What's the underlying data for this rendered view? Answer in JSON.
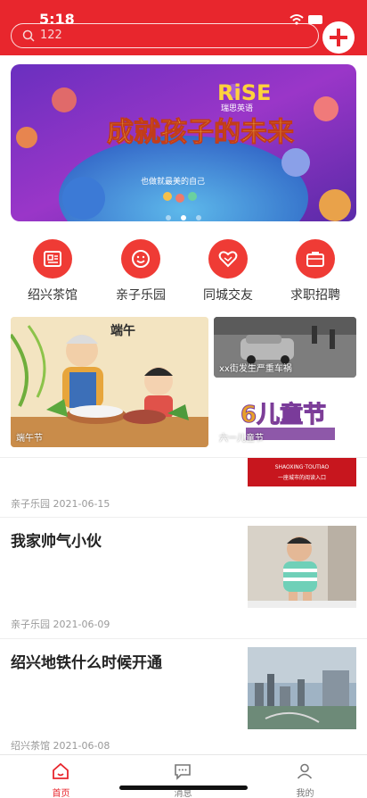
{
  "status": {
    "time": "5:18"
  },
  "search": {
    "placeholder": "122"
  },
  "banner": {
    "headline": "成就孩子的未来",
    "brand": "RiSE",
    "brand_sub": "瑞思英语",
    "slogan": "也做就最美的自己"
  },
  "categories": [
    {
      "label": "绍兴茶馆",
      "icon": "newspaper-icon"
    },
    {
      "label": "亲子乐园",
      "icon": "smiley-face-icon"
    },
    {
      "label": "同城交友",
      "icon": "heart-icon"
    },
    {
      "label": "求职招聘",
      "icon": "briefcase-icon"
    }
  ],
  "tiles": [
    {
      "label": "端午节",
      "overlay": "端午"
    },
    {
      "label": "xx街发生严重车祸"
    },
    {
      "label": "六一儿童节",
      "overlay": "6儿童节"
    }
  ],
  "articles": [
    {
      "title": "",
      "meta": "亲子乐园  2021-06-15",
      "img_text": "SHAOXING·TOUTIAO",
      "img_sub": "一座城市的阅读入口"
    },
    {
      "title": "我家帅气小伙",
      "meta": "亲子乐园  2021-06-09"
    },
    {
      "title": "绍兴地铁什么时候开通",
      "meta": "绍兴茶馆  2021-06-08"
    }
  ],
  "tabs": [
    {
      "label": "首页",
      "icon": "home-icon",
      "active": true
    },
    {
      "label": "消息",
      "icon": "message-icon",
      "active": false
    },
    {
      "label": "我的",
      "icon": "person-icon",
      "active": false
    }
  ],
  "colors": {
    "brand": "#e8262d",
    "icon_circle": "#ef3b35"
  }
}
